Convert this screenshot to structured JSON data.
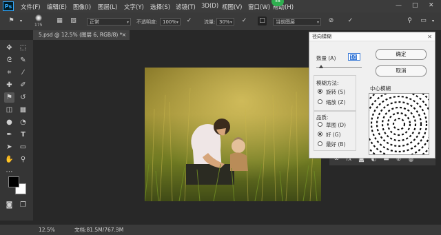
{
  "app": {
    "logo": "Ps",
    "notification_badge": "58"
  },
  "menu": [
    "文件(F)",
    "编辑(E)",
    "图像(I)",
    "图层(L)",
    "文字(Y)",
    "选择(S)",
    "滤镜(T)",
    "3D(D)",
    "视图(V)",
    "窗口(W)",
    "帮助(H)"
  ],
  "window_controls": {
    "minimize": "—",
    "restore": "□",
    "close": "✕"
  },
  "options": {
    "brush_size": "175",
    "mode": "正常",
    "opacity_label": "不透明度:",
    "opacity_value": "100%",
    "flow_label": "流量:",
    "flow_value": "30%",
    "sample_value": "当前图层"
  },
  "document": {
    "tab_title": "5.psd @ 12.5% (图层 6, RGB/8) *",
    "tab_close": "×"
  },
  "status": {
    "zoom": "12.5%",
    "doc_size": "文档:81.5M/767.3M"
  },
  "dialog": {
    "title": "径向模糊",
    "close": "✕",
    "amount_label": "数量 (A)",
    "amount_value": "10",
    "amount_fraction": 0.1,
    "ok_label": "确定",
    "cancel_label": "取消",
    "method_label": "模糊方法:",
    "method_spin": "旋转 (S)",
    "method_zoom": "缩放 (Z)",
    "quality_label": "品质:",
    "quality_draft": "草图 (D)",
    "quality_good": "好 (G)",
    "quality_best": "最好 (B)",
    "center_label": "中心模糊",
    "selected_method": "spin",
    "selected_quality": "good"
  },
  "colors": {
    "foreground": "#000000",
    "background": "#ffffff",
    "badge": "#2fae4f"
  }
}
